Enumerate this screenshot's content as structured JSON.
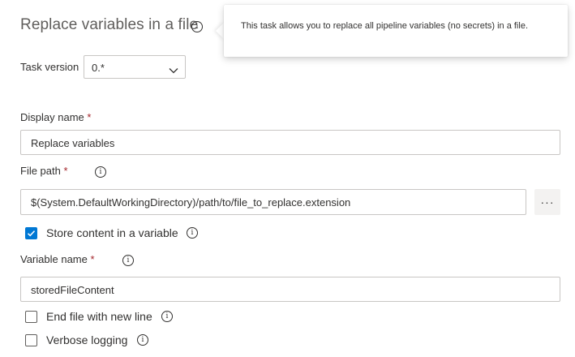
{
  "header": {
    "title": "Replace variables in a file",
    "tooltip": "This task allows you to replace all pipeline variables (no secrets) in a file."
  },
  "task_version": {
    "label": "Task version",
    "value": "0.*"
  },
  "display_name": {
    "label": "Display name",
    "required_mark": "*",
    "value": "Replace variables"
  },
  "file_path": {
    "label": "File path",
    "required_mark": "*",
    "value": "$(System.DefaultWorkingDirectory)/path/to/file_to_replace.extension",
    "browse_label": "···"
  },
  "store_content": {
    "label": "Store content in a variable",
    "checked": true
  },
  "variable_name": {
    "label": "Variable name",
    "required_mark": "*",
    "value": "storedFileContent"
  },
  "end_newline": {
    "label": "End file with new line",
    "checked": false
  },
  "verbose": {
    "label": "Verbose logging",
    "checked": false
  },
  "colors": {
    "accent": "#0078d4",
    "required": "#a4262c",
    "border": "#c8c6c4"
  },
  "icons": [
    "info-icon",
    "chevron-down-icon",
    "checkmark-icon",
    "more-icon"
  ]
}
